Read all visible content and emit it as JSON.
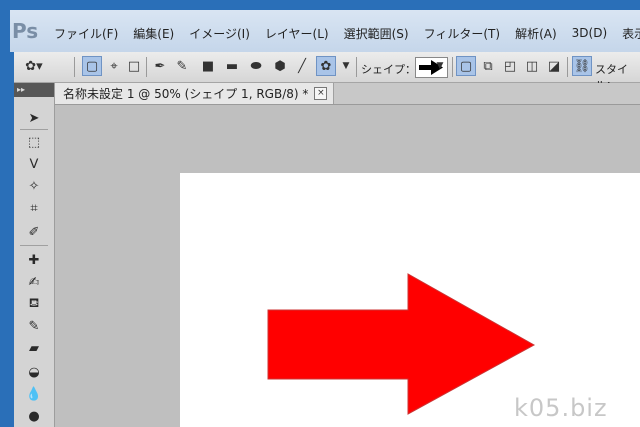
{
  "app": {
    "logo": "Ps"
  },
  "menu": [
    "ファイル(F)",
    "編集(E)",
    "イメージ(I)",
    "レイヤー(L)",
    "選択範囲(S)",
    "フィルター(T)",
    "解析(A)",
    "3D(D)",
    "表示(V)"
  ],
  "options": {
    "shape_label": "シェイプ：",
    "style_label": "スタイル："
  },
  "document": {
    "tab_title": "名称未設定 1 @ 50% (シェイプ 1, RGB/8) *",
    "close_glyph": "×"
  },
  "shape": {
    "fill": "#ff0000",
    "stroke": "#cc3333"
  },
  "watermark": "k05.biz"
}
